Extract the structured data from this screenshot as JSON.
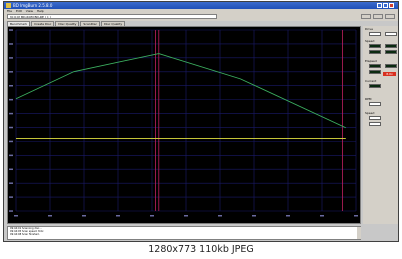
{
  "window": {
    "title": "BD ImgBurn 2.5.8.0"
  },
  "menu": [
    "File",
    "Edit",
    "View",
    "Help"
  ],
  "toolbar": {
    "drive": "[0:0:0] BD-ROM BD-RE ( J: )"
  },
  "tabs": [
    {
      "label": "Benchmark"
    },
    {
      "label": "Create Disc"
    },
    {
      "label": "Disc Quality"
    },
    {
      "label": "ScanDisc"
    },
    {
      "label": "Disc Quality"
    }
  ],
  "side_panel": {
    "items": [
      {
        "label": "Drive"
      },
      {
        "label": "Speed"
      },
      {
        "label": "Elapsed"
      },
      {
        "label": "Current"
      }
    ],
    "speed_value": "8.0x",
    "rpm_label": "RPM",
    "speed_label": "Speed"
  },
  "log": [
    "09:44:01  Scanning disc...",
    "09:44:05  Scan speed: 8.0x",
    "09:44:08  Scan finished."
  ],
  "caption": "1280x773 110kb JPEG",
  "chart_data": {
    "type": "line",
    "series": [
      {
        "x": [
          0,
          0.17,
          0.42,
          0.66,
          0.97
        ],
        "values": [
          0.62,
          0.77,
          0.87,
          0.73,
          0.46
        ],
        "color": "#3cb060"
      },
      {
        "x": [
          0,
          0.97
        ],
        "values": [
          0.4,
          0.4
        ],
        "color": "#e0e040"
      }
    ],
    "grid": true,
    "marker_lines": [
      0.41,
      0.42,
      0.96
    ],
    "colors": {
      "background": "#000000",
      "grid": "#1a1a6a",
      "marker": "#c02060"
    }
  }
}
